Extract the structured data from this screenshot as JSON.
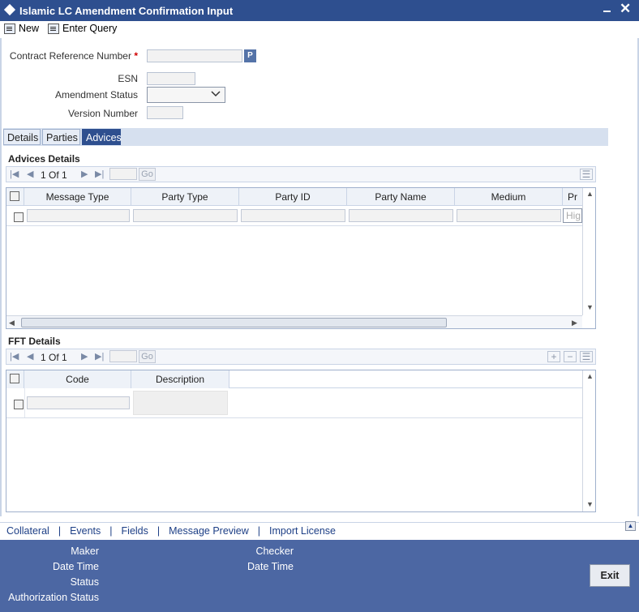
{
  "window": {
    "title": "Islamic LC Amendment Confirmation Input"
  },
  "toolbar": {
    "new_label": "New",
    "enter_query_label": "Enter Query"
  },
  "form": {
    "contract_ref_label": "Contract Reference Number",
    "required_mark": "*",
    "lov_button": "P",
    "esn_label": "ESN",
    "amendment_status_label": "Amendment Status",
    "version_number_label": "Version Number"
  },
  "tabs": [
    {
      "label": "Details",
      "active": false
    },
    {
      "label": "Parties",
      "active": false
    },
    {
      "label": "Advices",
      "active": true
    }
  ],
  "advices": {
    "title": "Advices Details",
    "pager": {
      "current": "1",
      "of_label": "Of",
      "total": "1",
      "go_label": "Go"
    },
    "columns": [
      "Message Type",
      "Party Type",
      "Party ID",
      "Party Name",
      "Medium",
      "Pr"
    ],
    "row_placeholder": "Hig"
  },
  "fft": {
    "title": "FFT Details",
    "pager": {
      "current": "1",
      "of_label": "Of",
      "total": "1",
      "go_label": "Go"
    },
    "columns": [
      "Code",
      "Description"
    ]
  },
  "links": [
    "Collateral",
    "Events",
    "Fields",
    "Message Preview",
    "Import License"
  ],
  "link_separator": "|",
  "footer": {
    "maker_label": "Maker",
    "date_time_label": "Date Time",
    "status_label": "Status",
    "auth_status_label": "Authorization Status",
    "checker_label": "Checker",
    "checker_date_time_label": "Date Time",
    "exit_label": "Exit"
  },
  "colors": {
    "titlebar": "#2e4f8f",
    "footer": "#4c67a3",
    "link": "#1d3f86"
  }
}
